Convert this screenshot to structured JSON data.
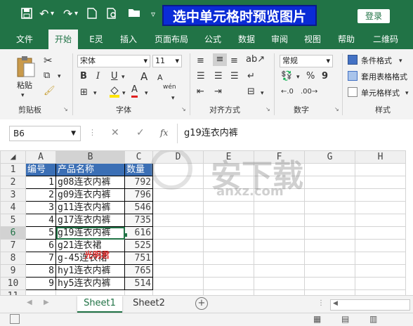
{
  "title_bar": {
    "title": "选中单元格时预览图片",
    "login_label": "登录",
    "qa_icons": [
      "save-icon",
      "undo-icon",
      "redo-icon",
      "document-icon",
      "print-preview-icon",
      "open-folder-icon",
      "customize-icon"
    ]
  },
  "tabs": [
    "文件",
    "开始",
    "E灵",
    "插入",
    "页面布局",
    "公式",
    "数据",
    "审阅",
    "视图",
    "帮助",
    "二维码"
  ],
  "active_tab": "开始",
  "ribbon": {
    "clipboard": {
      "paste_label": "粘贴",
      "group_label": "剪贴板"
    },
    "font": {
      "font_name": "宋体",
      "font_size": "11",
      "bold": "B",
      "italic": "I",
      "underline": "U",
      "grow": "A",
      "shrink": "A",
      "color_a": "A",
      "wen": "wén",
      "group_label": "字体"
    },
    "alignment": {
      "group_label": "对齐方式"
    },
    "number": {
      "format": "常规",
      "percent": "%",
      "comma": "9",
      "group_label": "数字"
    },
    "styles": {
      "conditional": "条件格式",
      "table_format": "套用表格格式",
      "cell_style": "单元格样式",
      "group_label": "样式"
    }
  },
  "formula_bar": {
    "name_box": "B6",
    "cancel": "✕",
    "enter": "✓",
    "fx": "fx",
    "content": "g19连衣内裤"
  },
  "grid": {
    "columns": [
      "A",
      "B",
      "C",
      "D",
      "E",
      "F",
      "G",
      "H"
    ],
    "selected_column": "B",
    "selected_row": "6",
    "header_row": [
      "编号",
      "产品名称",
      "数量"
    ],
    "rows": [
      {
        "row": "2",
        "a": "1",
        "b": "g08连衣内裤",
        "c": "792"
      },
      {
        "row": "3",
        "a": "2",
        "b": "g09连衣内裤",
        "c": "796"
      },
      {
        "row": "4",
        "a": "3",
        "b": "g11连衣内裤",
        "c": "546"
      },
      {
        "row": "5",
        "a": "4",
        "b": "g17连衣内裤",
        "c": "735"
      },
      {
        "row": "6",
        "a": "5",
        "b": "g19连衣内裤",
        "c": "616"
      },
      {
        "row": "7",
        "a": "6",
        "b": "g21连衣裙",
        "c": "525"
      },
      {
        "row": "8",
        "a": "7",
        "b": "g-45连衣裙",
        "c": "751"
      },
      {
        "row": "9",
        "a": "8",
        "b": "hy1连衣内裤",
        "c": "765"
      },
      {
        "row": "10",
        "a": "9",
        "b": "hy5连衣内裤",
        "c": "514"
      }
    ],
    "watermark_text": "安下载",
    "watermark_url": "anxz.com",
    "red_mark": "光明君"
  },
  "sheets": [
    "Sheet1",
    "Sheet2"
  ],
  "active_sheet": "Sheet1"
}
